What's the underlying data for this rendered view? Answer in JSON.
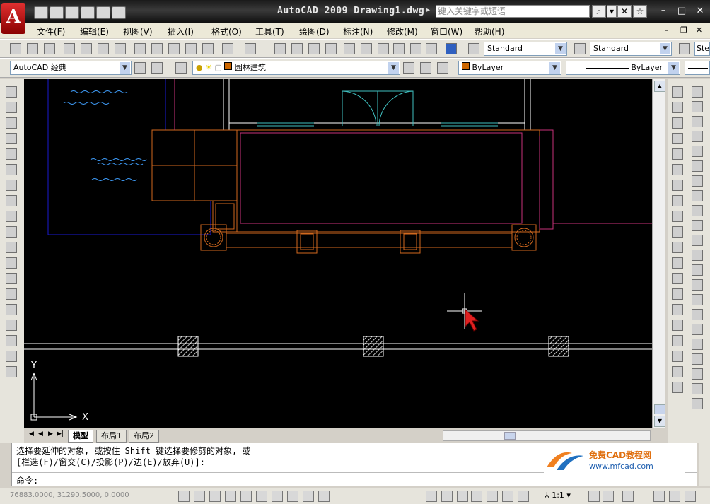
{
  "window": {
    "title": "AutoCAD 2009 Drawing1.dwg",
    "logo_text": "A",
    "search_placeholder": "键入关键字或短语"
  },
  "menu": [
    "文件(F)",
    "编辑(E)",
    "视图(V)",
    "插入(I)",
    "格式(O)",
    "工具(T)",
    "绘图(D)",
    "标注(N)",
    "修改(M)",
    "窗口(W)",
    "帮助(H)"
  ],
  "toolbar1": {
    "text_style": "Standard",
    "dim_style": "Standard",
    "dim_style_partial": "Ste"
  },
  "toolbar2": {
    "workspace": "AutoCAD 经典",
    "layer": "园林建筑",
    "color": "ByLayer",
    "linetype": "ByLayer",
    "layer_color": "#cc6600"
  },
  "drawing": {
    "ucs_x": "X",
    "ucs_y": "Y"
  },
  "tabs": [
    "模型",
    "布局1",
    "布局2"
  ],
  "command": {
    "line1": "选择要延伸的对象, 或按住 Shift 键选择要修剪的对象, 或",
    "line2": "[栏选(F)/窗交(C)/投影(P)/边(E)/放弃(U)]:",
    "prompt": "命令:"
  },
  "watermark": {
    "title": "免费CAD教程网",
    "url": "www.mfcad.com"
  },
  "status": {
    "coords": "76883.0000, 31290.5000, 0.0000",
    "scale": "1:1"
  },
  "colors": {
    "canvas_bg": "#000000",
    "orange": "#d2691e",
    "magenta": "#c8327a",
    "cyan": "#40c0c0",
    "blue": "#1a1ad0"
  }
}
